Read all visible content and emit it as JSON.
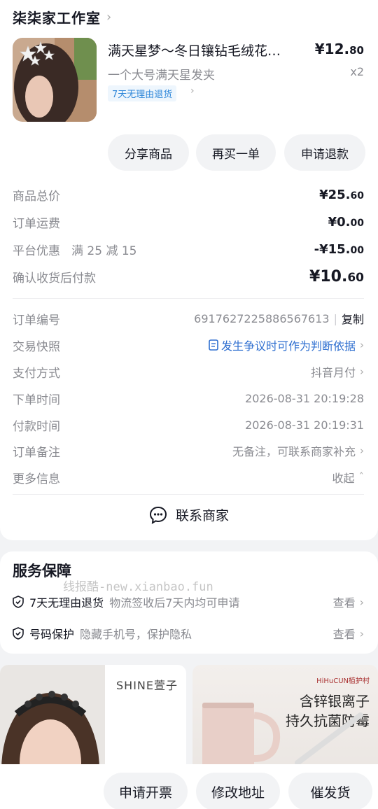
{
  "shop": {
    "name": "柒柒家工作室",
    "chevron": "›"
  },
  "product": {
    "title": "满天星梦～冬日镶钻毛绒花…",
    "price_main": "¥12.",
    "price_cents": "80",
    "spec": "一个大号满天星发夹",
    "qty": "x2",
    "return_tag": "7天无理由退货"
  },
  "actions": {
    "share": "分享商品",
    "rebuy": "再买一单",
    "refund": "申请退款"
  },
  "costs": {
    "subtotal_label": "商品总价",
    "subtotal_main": "¥25.",
    "subtotal_cents": "60",
    "shipping_label": "订单运费",
    "shipping_main": "¥0.",
    "shipping_cents": "00",
    "discount_label": "平台优惠",
    "discount_rule": "满 25 减 15",
    "discount_main": "-¥15.",
    "discount_cents": "00",
    "pay_label": "确认收货后付款",
    "pay_main": "¥10.",
    "pay_cents": "60"
  },
  "info": {
    "order_no_label": "订单编号",
    "order_no": "6917627225886567613",
    "copy": "复制",
    "snapshot_label": "交易快照",
    "snapshot_value": "发生争议时可作为判断依据",
    "pay_method_label": "支付方式",
    "pay_method": "抖音月付",
    "order_time_label": "下单时间",
    "order_time": "2026-08-31 20:19:28",
    "pay_time_label": "付款时间",
    "pay_time": "2026-08-31 20:19:31",
    "note_label": "订单备注",
    "note": "无备注，可联系商家补充",
    "more_label": "更多信息",
    "collapse": "收起"
  },
  "contact": {
    "label": "联系商家"
  },
  "service": {
    "title": "服务保障",
    "items": [
      {
        "name": "7天无理由退货",
        "desc": "物流签收后7天内均可申请",
        "action": "查看"
      },
      {
        "name": "号码保护",
        "desc": "隐藏手机号，保护隐私",
        "action": "查看"
      }
    ]
  },
  "watermark": "线报酷-new.xianbao.fun",
  "ads": {
    "left_brand": "SHINE萱子",
    "right_brand": "HiHuCUN植护村",
    "right_line1": "含锌银离子",
    "right_line2": "持久抗菌防霉"
  },
  "bottom": {
    "invoice": "申请开票",
    "address": "修改地址",
    "urge": "催发货"
  }
}
